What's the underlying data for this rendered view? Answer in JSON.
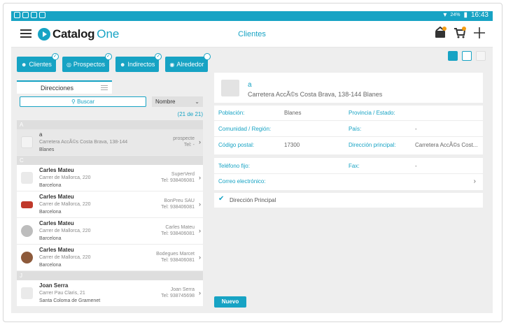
{
  "statusbar": {
    "battery": "24%",
    "time": "16:43"
  },
  "header": {
    "logo_part1": "Catalog",
    "logo_part2": "One",
    "title": "Clientes"
  },
  "filters": [
    {
      "label": "Clientes",
      "icon": "people-icon"
    },
    {
      "label": "Prospectos",
      "icon": "target-icon"
    },
    {
      "label": "Indirectos",
      "icon": "people-icon"
    },
    {
      "label": "Alrededor",
      "icon": "location-icon"
    }
  ],
  "left": {
    "tab_label": "Direcciones",
    "search_placeholder": "Buscar",
    "sort_value": "Nombre",
    "count": "(21 de 21)",
    "sections": [
      "A",
      "C",
      "J"
    ],
    "rows": [
      {
        "name": "a",
        "addr": "Carretera AccÃ©s Costa Brava, 138-144",
        "city": "Blanes",
        "r1": "prospecte",
        "r2": "Tel: -"
      },
      {
        "name": "Carles Mateu",
        "addr": "Carrer de Mallorca, 220",
        "city": "Barcelona",
        "r1": "SuperVerd",
        "r2": "Tel: 938406081"
      },
      {
        "name": "Carles Mateu",
        "addr": "Carrer de Mallorca, 220",
        "city": "Barcelona",
        "r1": "BonPreu SAU",
        "r2": "Tel: 938406081"
      },
      {
        "name": "Carles Mateu",
        "addr": "Carrer de Mallorca, 220",
        "city": "Barcelona",
        "r1": "Carles Mateu",
        "r2": "Tel: 938406081"
      },
      {
        "name": "Carles Mateu",
        "addr": "Carrer de Mallorca, 220",
        "city": "Barcelona",
        "r1": "Bodegues Marcet",
        "r2": "Tel: 938406081"
      },
      {
        "name": "Joan Serra",
        "addr": "Carrer Pau Claris, 21",
        "city": "Santa Coloma de Gramenet",
        "r1": "Joan Serra",
        "r2": "Tel: 938745698"
      }
    ]
  },
  "detail": {
    "title": "a",
    "subtitle": "Carretera AccÃ©s Costa Brava, 138-144 Blanes",
    "poblacion_label": "Población:",
    "poblacion_value": "Blanes",
    "provincia_label": "Provincia / Estado:",
    "comunidad_label": "Comunidad / Región:",
    "pais_label": "País:",
    "pais_value": "-",
    "cp_label": "Código postal:",
    "cp_value": "17300",
    "dirprincipal_label": "Dirección principal:",
    "dirprincipal_value": "Carretera AccÃ©s Cost...",
    "telefono_label": "Teléfono fijo:",
    "fax_label": "Fax:",
    "fax_value": "-",
    "correo_label": "Correo electrónico:",
    "principal_check": "Dirección Principal",
    "nuevo": "Nuevo"
  }
}
